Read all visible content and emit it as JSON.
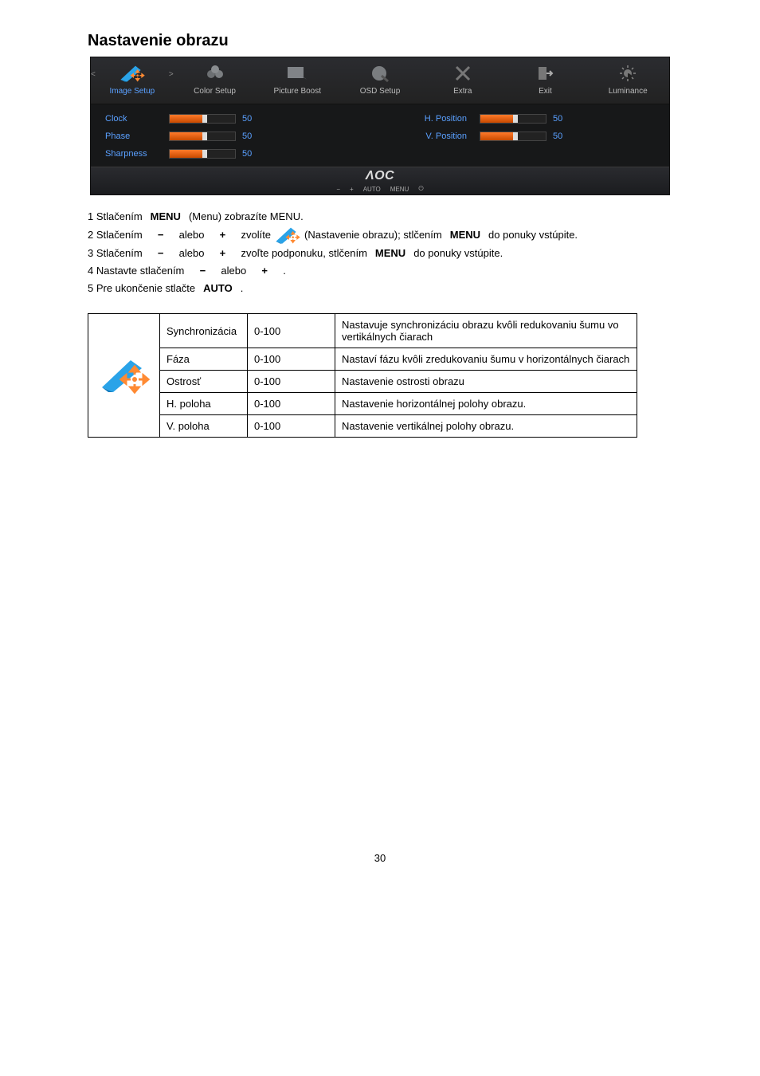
{
  "heading": "Nastavenie obrazu",
  "osd": {
    "tabs": [
      {
        "id": "image-setup",
        "label": "Image Setup",
        "active": true
      },
      {
        "id": "color-setup",
        "label": "Color Setup",
        "active": false
      },
      {
        "id": "picture-boost",
        "label": "Picture Boost",
        "active": false
      },
      {
        "id": "osd-setup",
        "label": "OSD Setup",
        "active": false
      },
      {
        "id": "extra",
        "label": "Extra",
        "active": false
      },
      {
        "id": "exit",
        "label": "Exit",
        "active": false
      },
      {
        "id": "luminance",
        "label": "Luminance",
        "active": false
      }
    ],
    "left": [
      {
        "id": "clock",
        "label": "Clock",
        "value": 50
      },
      {
        "id": "phase",
        "label": "Phase",
        "value": 50
      },
      {
        "id": "sharpness",
        "label": "Sharpness",
        "value": 50
      }
    ],
    "right": [
      {
        "id": "h-position",
        "label": "H. Position",
        "value": 50
      },
      {
        "id": "v-position",
        "label": "V. Position",
        "value": 50
      }
    ],
    "logo": "ΛOC",
    "footer_buttons": [
      "−",
      "+",
      "AUTO",
      "MENU",
      "⏻"
    ]
  },
  "instructions": {
    "step1_a": "1 Stlačením",
    "step1_key": "MENU",
    "step1_b": "(Menu) zobrazíte MENU.",
    "step2_a": "2 Stlačením",
    "step2_minus": "−",
    "step2_or1": "alebo",
    "step2_plus": "+",
    "step2_b": "zvolíte",
    "step2_c": "(Nastavenie obrazu); stlčením",
    "step2_key": "MENU",
    "step2_d": "do ponuky vstúpite.",
    "step3_a": "3 Stlačením",
    "step3_minus": "−",
    "step3_or1": "alebo",
    "step3_plus": "+",
    "step3_b": "zvoľte podponuku, stlčením",
    "step3_key": "MENU",
    "step3_c": "do ponuky vstúpite.",
    "step4_a": "4 Nastavte stlačením",
    "step4_minus": "−",
    "step4_or1": "alebo",
    "step4_plus": "+",
    "step4_b": ".",
    "step5_a": "5 Pre ukončenie stlačte",
    "step5_key": "AUTO",
    "step5_b": "."
  },
  "table": {
    "rows": [
      {
        "name": "Synchronizácia",
        "range": "0-100",
        "desc": "Nastavuje synchronizáciu obrazu kvôli redukovaniu šumu vo vertikálnych čiarach"
      },
      {
        "name": "Fáza",
        "range": "0-100",
        "desc": "Nastaví fázu kvôli zredukovaniu šumu v horizontálnych čiarach"
      },
      {
        "name": "Ostrosť",
        "range": "0-100",
        "desc": "Nastavenie ostrosti obrazu"
      },
      {
        "name": "H. poloha",
        "range": "0-100",
        "desc": "Nastavenie horizontálnej polohy obrazu."
      },
      {
        "name": "V. poloha",
        "range": "0-100",
        "desc": "Nastavenie vertikálnej polohy obrazu."
      }
    ]
  },
  "page_number": "30"
}
